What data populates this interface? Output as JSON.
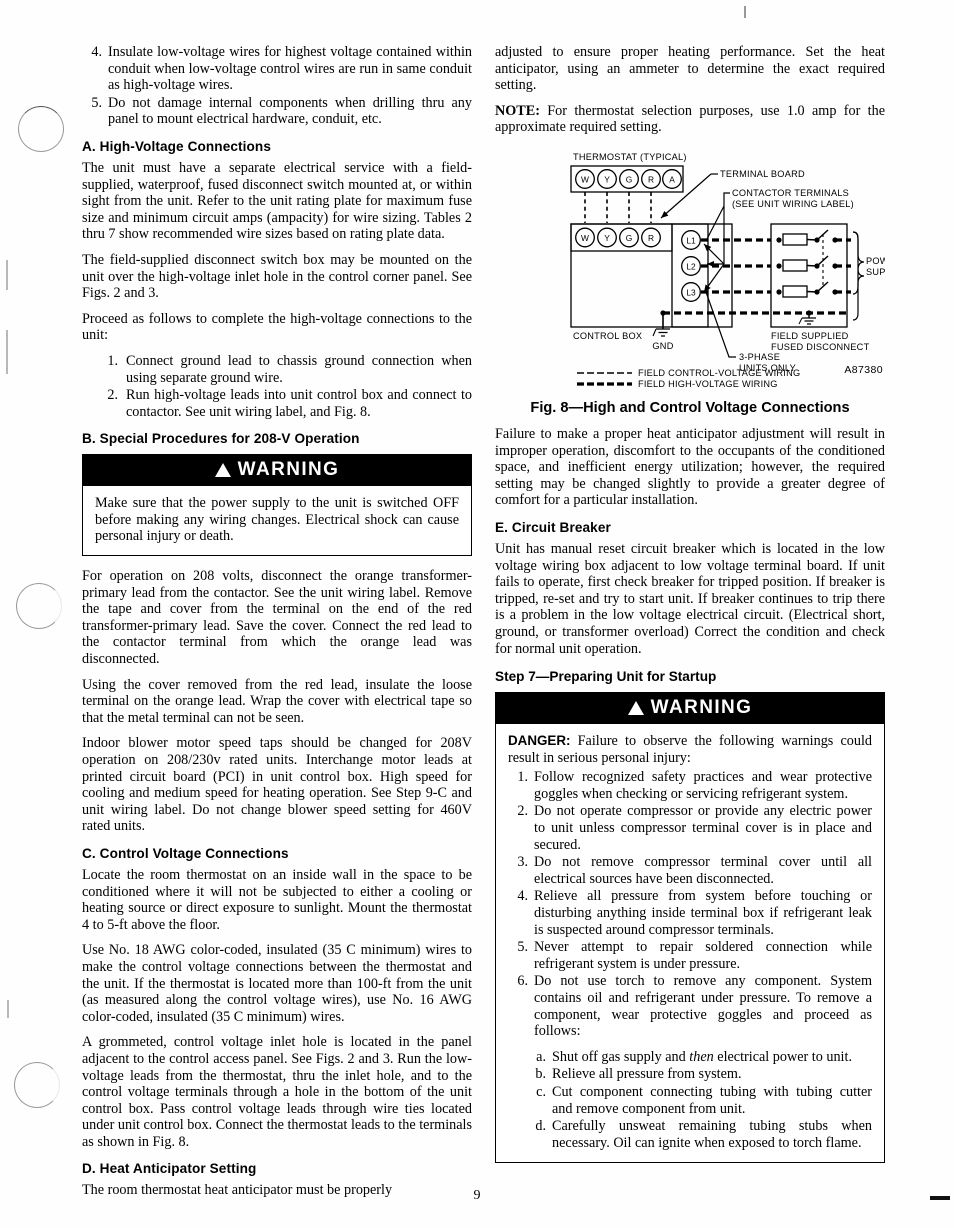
{
  "page": {
    "number": "9"
  },
  "left_column": {
    "top_list": [
      {
        "marker": "4.",
        "text": "Insulate low-voltage wires for highest voltage contained within conduit when low-voltage control wires are run in same conduit as high-voltage wires."
      },
      {
        "marker": "5.",
        "text": "Do not damage internal components when drilling thru any panel to mount electrical hardware, conduit, etc."
      }
    ],
    "section_a": {
      "heading": "A.  High-Voltage Connections",
      "p1": "The unit must have a separate electrical service with a field-supplied, waterproof, fused disconnect switch mounted at, or within sight from the unit. Refer to the unit rating plate for maximum fuse size and minimum circuit amps (ampacity) for wire sizing. Tables 2 thru 7 show recommended wire sizes based on rating plate data.",
      "p2": "The field-supplied disconnect switch box may be mounted on the unit over the high-voltage inlet hole in the control corner panel. See Figs. 2 and 3.",
      "p3": "Proceed as follows to complete the high-voltage connections to the unit:",
      "steps": [
        {
          "marker": "1.",
          "text": "Connect ground lead to chassis ground connection when using separate ground wire."
        },
        {
          "marker": "2.",
          "text": "Run high-voltage leads into unit control box and connect to contactor. See unit wiring label, and Fig. 8."
        }
      ]
    },
    "section_b": {
      "heading": "B.  Special Procedures for 208-V Operation",
      "warning": {
        "title": "WARNING",
        "body": "Make sure that the power supply to the unit is switched OFF before making any wiring changes. Electrical shock can cause personal injury or death."
      },
      "p1": "For operation on 208 volts, disconnect the orange transformer-primary lead from the contactor. See the unit wiring label. Remove the tape and cover from the terminal on the end of the red transformer-primary lead. Save the cover. Connect the red lead to the contactor terminal from which the orange lead was disconnected.",
      "p2": "Using the cover removed from the red lead, insulate the loose terminal on the orange lead. Wrap the cover with electrical tape so that the metal terminal can not be seen.",
      "p3": "Indoor blower motor speed taps should be changed for 208V operation on 208/230v rated units. Interchange motor leads at printed circuit board (PCI) in unit control box. High speed for cooling and medium speed for heating operation. See Step 9-C and unit wiring label. Do not change blower speed setting for 460V rated units."
    },
    "section_c": {
      "heading": "C.  Control Voltage Connections",
      "p1": "Locate the room thermostat on an inside wall in the space to be conditioned where it will not be subjected to either a cooling or heating source or direct exposure to sunlight. Mount the thermostat 4 to 5-ft above the floor.",
      "p2": "Use No. 18 AWG color-coded, insulated (35 C minimum) wires to make the control voltage connections between the thermostat and the unit. If the thermostat is located more than 100-ft from the unit (as measured along the control voltage wires), use No. 16 AWG color-coded, insulated (35 C minimum) wires.",
      "p3": "A grommeted, control voltage inlet hole is located in the panel adjacent to the control access panel. See Figs. 2 and 3. Run the low-voltage leads from the thermostat, thru the inlet hole, and to the control voltage terminals through a hole in the bottom of the unit control box. Pass control voltage leads through wire ties located under unit control box. Connect the thermostat leads to the terminals as shown in Fig. 8."
    },
    "section_d": {
      "heading": "D.  Heat Anticipator Setting",
      "p1": "The room thermostat heat anticipator must be properly"
    }
  },
  "right_column": {
    "continued": "adjusted to ensure proper heating performance. Set the heat anticipator, using an ammeter to determine the exact required setting.",
    "note_label": "NOTE:",
    "note_text": " For thermostat selection purposes, use 1.0 amp for the approximate required setting.",
    "figure": {
      "caption": "Fig. 8—High and Control Voltage Connections",
      "drawing_id": "A87380",
      "labels": {
        "thermostat": "THERMOSTAT (TYPICAL)",
        "terminal_board": "TERMINAL BOARD",
        "contactor_terminals_1": "CONTACTOR TERMINALS",
        "contactor_terminals_2": "(SEE UNIT WIRING LABEL)",
        "control_box": "CONTROL BOX",
        "gnd": "GND",
        "field_supplied": "FIELD SUPPLIED",
        "fused_disconnect": "FUSED DISCONNECT",
        "power": "POWER",
        "supply": "SUPPLY",
        "three_phase": "3-PHASE",
        "units_only": "UNITS ONLY"
      },
      "thermostat_terminals": [
        "W",
        "Y",
        "G",
        "R",
        "A"
      ],
      "board_terminals": [
        "W",
        "Y",
        "G",
        "R"
      ],
      "line_terminals": [
        "L1",
        "L2",
        "L3"
      ],
      "legend": [
        {
          "style": "thin-dashed",
          "text": "FIELD CONTROL-VOLTAGE WIRING"
        },
        {
          "style": "thick-dashed",
          "text": "FIELD HIGH-VOLTAGE WIRING"
        }
      ]
    },
    "after_figure": "Failure to make a proper heat anticipator adjustment will result in improper operation, discomfort to the occupants of the conditioned space, and inefficient energy utilization; however, the required setting may be changed slightly to provide a greater degree of comfort for a particular installation.",
    "section_e": {
      "heading": "E.  Circuit Breaker",
      "p1": "Unit has manual reset circuit breaker which is located in the low voltage wiring box adjacent to low voltage terminal board. If unit fails to operate, first check breaker for tripped position. If breaker is tripped, re-set and try to start unit. If breaker continues to trip there is a problem in the low voltage electrical circuit. (Electrical short, ground, or transformer overload) Correct the condition and check for normal unit operation."
    },
    "step7": {
      "heading": "Step 7—Preparing Unit for Startup",
      "warning": {
        "title": "WARNING",
        "danger_label": "DANGER:",
        "danger_text": " Failure to observe the following warnings could result in serious personal injury:",
        "items": [
          {
            "marker": "1.",
            "text": "Follow recognized safety practices and wear protective goggles when checking or servicing refrigerant system."
          },
          {
            "marker": "2.",
            "text": "Do not operate compressor or provide any electric power to unit unless compressor terminal cover is in place and secured."
          },
          {
            "marker": "3.",
            "text": "Do not remove compressor terminal cover until all electrical sources have been disconnected."
          },
          {
            "marker": "4.",
            "text": "Relieve all pressure from system before touching or disturbing anything inside terminal box if refrigerant leak is suspected around compressor terminals."
          },
          {
            "marker": "5.",
            "text": "Never attempt to repair soldered connection while refrigerant system is under pressure."
          },
          {
            "marker": "6.",
            "text": "Do not use torch to remove any component. System contains oil and refrigerant under pressure. To remove a component, wear protective goggles and proceed as follows:"
          }
        ],
        "sub_items": [
          {
            "marker": "a.",
            "pre": "Shut off gas supply and ",
            "em": "then",
            "post": " electrical power to unit."
          },
          {
            "marker": "b.",
            "pre": "Relieve all pressure from system.",
            "em": "",
            "post": ""
          },
          {
            "marker": "c.",
            "pre": "Cut component connecting tubing with tubing cutter and remove component from unit.",
            "em": "",
            "post": ""
          },
          {
            "marker": "d.",
            "pre": "Carefully unsweat remaining tubing stubs when necessary. Oil can ignite when exposed to torch flame.",
            "em": "",
            "post": ""
          }
        ]
      }
    }
  }
}
